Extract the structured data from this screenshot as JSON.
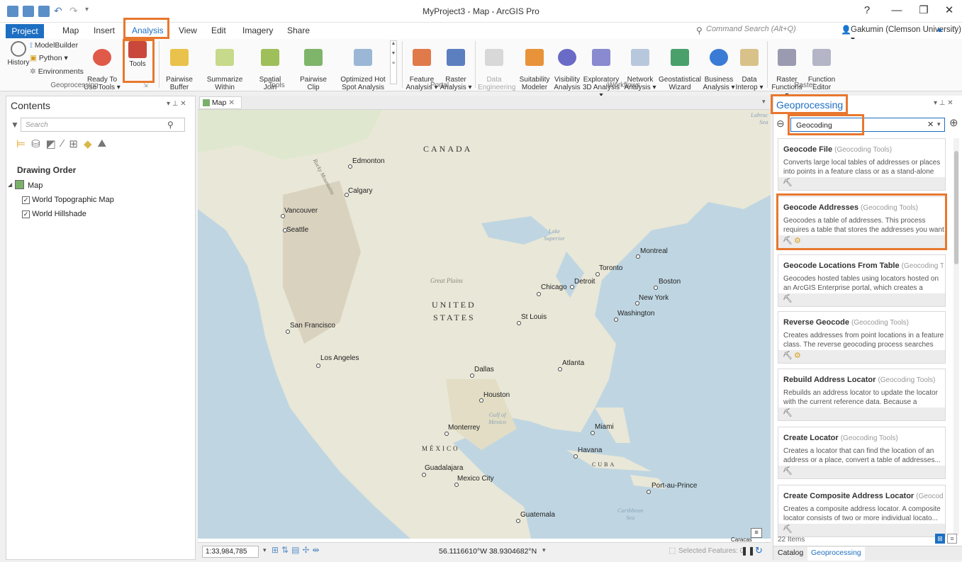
{
  "window": {
    "title": "MyProject3 - Map - ArcGIS Pro",
    "help": "?",
    "minimize": "—",
    "restore": "❐",
    "close": "✕"
  },
  "tabs": [
    {
      "label": "Project"
    },
    {
      "label": "Map"
    },
    {
      "label": "Insert"
    },
    {
      "label": "Analysis"
    },
    {
      "label": "View"
    },
    {
      "label": "Edit"
    },
    {
      "label": "Imagery"
    },
    {
      "label": "Share"
    }
  ],
  "command_search": {
    "placeholder": "Command Search (Alt+Q)"
  },
  "user": {
    "name": "Gakumin (Clemson University) ▾"
  },
  "ribbon": {
    "geoprocessing": {
      "label": "Geoprocessing",
      "history": "History",
      "modelbuilder": "ModelBuilder",
      "python": "Python ▾",
      "environments": "Environments",
      "ready_to_use": "Ready To\nUse Tools ▾",
      "tools": "Tools"
    },
    "tools": {
      "label": "Tools",
      "items": [
        "Pairwise\nBuffer",
        "Summarize\nWithin",
        "Spatial\nJoin",
        "Pairwise\nClip",
        "Optimized Hot\nSpot Analysis"
      ]
    },
    "portal": {
      "label": "Portal",
      "items": [
        "Feature\nAnalysis ▾",
        "Raster\nAnalysis ▾"
      ]
    },
    "workflows": {
      "label": "Workflows",
      "items": [
        "Data\nEngineering",
        "Suitability\nModeler",
        "Visibility\nAnalysis",
        "Exploratory\n3D Analysis ▾",
        "Network\nAnalysis ▾",
        "Geostatistical\nWizard",
        "Business\nAnalysis ▾",
        "Data\nInterop ▾"
      ]
    },
    "raster": {
      "label": "Raster",
      "items": [
        "Raster\nFunctions ▾",
        "Function\nEditor"
      ]
    }
  },
  "contents": {
    "title": "Contents",
    "search_placeholder": "Search",
    "drawing_order": "Drawing Order",
    "map_name": "Map",
    "layers": [
      "World Topographic Map",
      "World Hillshade"
    ]
  },
  "map_view": {
    "tab": "Map",
    "scale": "1:33,984,785",
    "coordinates": "56.1116610°W 38.9304682°N",
    "selected_features": "Selected Features: 0",
    "labels": {
      "canada": "CANADA",
      "us_line1": "UNITED",
      "us_line2": "STATES",
      "mexico": "MÉXICO",
      "cuba": "CUBA",
      "great_plains": "Great Plains",
      "rocky": "Rocky Mountains",
      "lake_superior": "Lake\nSuperior",
      "gulf": "Gulf of\nMexico",
      "caribbean": "Caribbean\nSea",
      "labrador": "Labrac\nSea",
      "caracas": "Caracas"
    },
    "cities": [
      "Edmonton",
      "Calgary",
      "Vancouver",
      "Seattle",
      "Montreal",
      "Toronto",
      "Boston",
      "Detroit",
      "Chicago",
      "New York",
      "Washington",
      "St Louis",
      "San Francisco",
      "Los Angeles",
      "Atlanta",
      "Dallas",
      "Houston",
      "Monterrey",
      "Miami",
      "Havana",
      "Guadalajara",
      "Mexico City",
      "Port-au-Prince",
      "Guatemala"
    ]
  },
  "geoprocessing": {
    "title": "Geoprocessing",
    "search_value": "Geocoding",
    "results": [
      {
        "name": "Geocode File",
        "category": "(Geocoding Tools)",
        "desc": "Converts large local tables of addresses or places into points in a feature class or as a stand-alone .c..."
      },
      {
        "name": "Geocode Addresses",
        "category": "(Geocoding Tools)",
        "desc": "Geocodes a table of addresses. This process requires a table that stores the addresses you want to geoc..."
      },
      {
        "name": "Geocode Locations From Table",
        "category": "(Geocoding Tools)",
        "desc": "Geocodes hosted tables using locators hosted on an ArcGIS Enterprise portal, which creates a hosted fe..."
      },
      {
        "name": "Reverse Geocode",
        "category": "(Geocoding Tools)",
        "desc": "Creates addresses from point locations in a feature class. The reverse geocoding process searches fo..."
      },
      {
        "name": "Rebuild Address Locator",
        "category": "(Geocoding Tools)",
        "desc": "Rebuilds an address locator to update the locator with the current reference data. Because a locator..."
      },
      {
        "name": "Create Locator",
        "category": "(Geocoding Tools)",
        "desc": "Creates a locator that can find the location of an address or a place, convert a table of addresses..."
      },
      {
        "name": "Create Composite Address Locator",
        "category": "(Geocoding...",
        "desc": "Creates a composite address locator. A composite locator consists of two or more individual locato..."
      }
    ],
    "item_count": "22 Items",
    "bottom_tabs": [
      "Catalog",
      "Geoprocessing"
    ]
  },
  "accent": {
    "highlight": "#e8772e",
    "project_tab": "#1d6fc2"
  }
}
